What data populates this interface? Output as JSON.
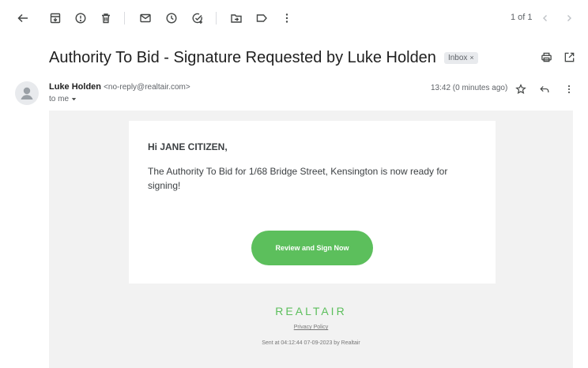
{
  "toolbar": {
    "icons": [
      "back-arrow-icon",
      "archive-icon",
      "report-spam-icon",
      "delete-icon",
      "mark-unread-icon",
      "snooze-icon",
      "add-to-tasks-icon",
      "move-to-icon",
      "labels-icon",
      "more-vert-icon"
    ]
  },
  "pager": {
    "text": "1 of 1"
  },
  "message": {
    "subject": "Authority To Bid - Signature Requested by Luke Holden",
    "label": "Inbox",
    "label_close": "×",
    "sender_name": "Luke Holden",
    "sender_email": "<no-reply@realtair.com>",
    "to": "to me",
    "timestamp": "13:42 (0 minutes ago)"
  },
  "email_body": {
    "greeting": "Hi JANE CITIZEN,",
    "text": "The Authority To Bid for 1/68 Bridge Street, Kensington is now ready for signing!",
    "button_label": "Review and Sign Now",
    "brand": "REALTAIR",
    "privacy_link": "Privacy Policy",
    "sent_info": "Sent at 04:12:44 07-09-2023 by Realtair"
  },
  "colors": {
    "accent_green": "#5cbf5c",
    "canvas_gray": "#f2f2f2"
  }
}
